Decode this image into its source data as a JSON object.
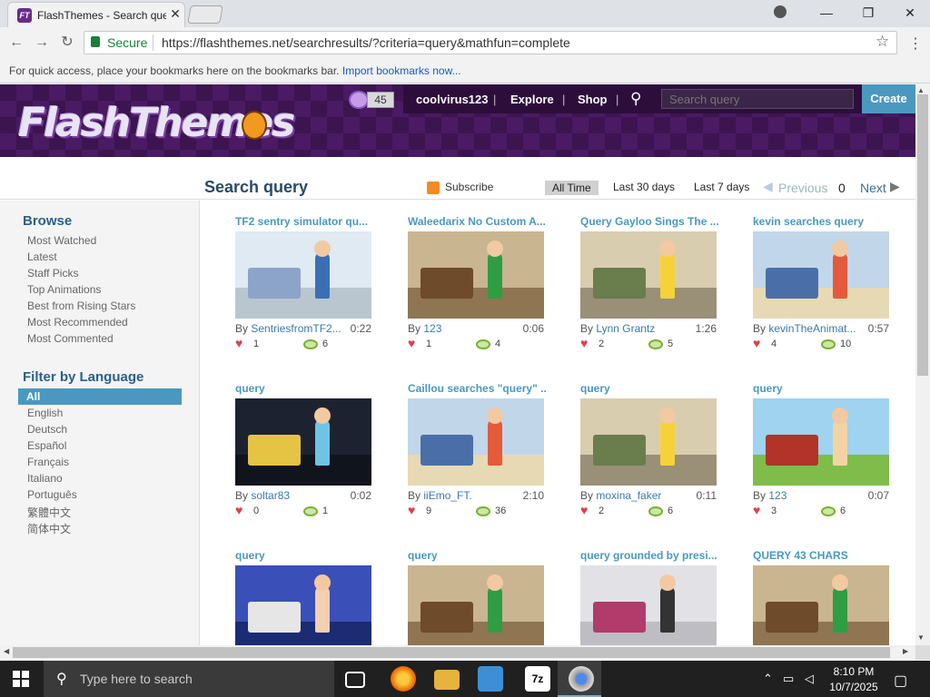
{
  "browser": {
    "tab_title": "FlashThemes - Search query",
    "tab_favicon_text": "FT",
    "url": "https://flashthemes.net/searchresults/?criteria=query&mathfun=complete",
    "secure_label": "Secure",
    "bookmarks_text": "For quick access, place your bookmarks here on the bookmarks bar.",
    "bookmarks_link": "Import bookmarks now..."
  },
  "site": {
    "logo": "FlashThemes",
    "coins": "45",
    "username": "coolvirus123",
    "nav": [
      "Explore",
      "Shop"
    ],
    "search_placeholder": "Search query",
    "create_label": "Create"
  },
  "page": {
    "title": "Search query",
    "subscribe": "Subscribe",
    "timeframes": [
      "All Time",
      "Last 30 days",
      "Last 7 days"
    ],
    "prev": "Previous",
    "page_num": "0",
    "next": "Next"
  },
  "sidebar": {
    "browse_title": "Browse",
    "browse_links": [
      "Most Watched",
      "Latest",
      "Staff Picks",
      "Top Animations",
      "Best from Rising Stars",
      "Most Recommended",
      "Most Commented"
    ],
    "lang_title": "Filter by Language",
    "languages": [
      "All",
      "English",
      "Deutsch",
      "Español",
      "Français",
      "Italiano",
      "Português",
      "繁體中文",
      "简体中文"
    ]
  },
  "cards": [
    {
      "title": "TF2 sentry simulator qu...",
      "by_prefix": "By",
      "author": "SentriesfromTF2...",
      "duration": "0:22",
      "likes": "1",
      "views": "6",
      "scene": "hospital"
    },
    {
      "title": "Waleedarix No Custom A...",
      "by_prefix": "By",
      "author": "123",
      "duration": "0:06",
      "likes": "1",
      "views": "4",
      "scene": "bedroom"
    },
    {
      "title": "Query Gayloo Sings The ...",
      "by_prefix": "By",
      "author": "Lynn Grantz",
      "duration": "1:26",
      "likes": "2",
      "views": "5",
      "scene": "livingroom"
    },
    {
      "title": "kevin searches query",
      "by_prefix": "By",
      "author": "kevinTheAnimat...",
      "duration": "0:57",
      "likes": "4",
      "views": "10",
      "scene": "kidroom"
    },
    {
      "title": "query",
      "by_prefix": "By",
      "author": "soltar83",
      "duration": "0:02",
      "likes": "0",
      "views": "1",
      "scene": "spaceship"
    },
    {
      "title": "Caillou searches \"query\" ...",
      "by_prefix": "By",
      "author": "iiEmo_FT.",
      "duration": "2:10",
      "likes": "9",
      "views": "36",
      "scene": "kidroom"
    },
    {
      "title": "query",
      "by_prefix": "By",
      "author": "moxina_faker",
      "duration": "0:11",
      "likes": "2",
      "views": "6",
      "scene": "livingroom"
    },
    {
      "title": "query",
      "by_prefix": "By",
      "author": "123",
      "duration": "0:07",
      "likes": "3",
      "views": "6",
      "scene": "farm"
    },
    {
      "title": "query",
      "by_prefix": "",
      "author": "",
      "duration": "",
      "likes": "",
      "views": "",
      "scene": "cartoon"
    },
    {
      "title": "query",
      "by_prefix": "",
      "author": "",
      "duration": "",
      "likes": "",
      "views": "",
      "scene": "bedroom"
    },
    {
      "title": "query grounded by presi...",
      "by_prefix": "",
      "author": "",
      "duration": "",
      "likes": "",
      "views": "",
      "scene": "stage"
    },
    {
      "title": "QUERY 43 CHARS",
      "by_prefix": "",
      "author": "",
      "duration": "",
      "likes": "",
      "views": "",
      "scene": "bedroom"
    }
  ],
  "taskbar": {
    "search_text": "Type here to search",
    "time": "8:10 PM",
    "date": "10/7/2025"
  },
  "colors": {
    "accent": "#4a98c0",
    "header_purple": "#3c1450",
    "secure_green": "#188038"
  }
}
